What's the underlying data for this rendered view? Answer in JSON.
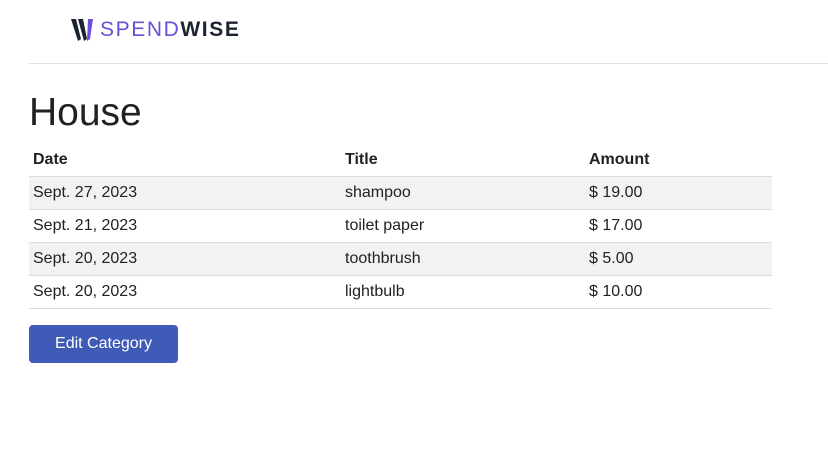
{
  "brand": {
    "spend": "SPEND",
    "wise": "WISE",
    "accent_color": "#6b4fd8",
    "dark_color": "#1b2230"
  },
  "page": {
    "title": "House"
  },
  "table": {
    "headers": {
      "date": "Date",
      "title": "Title",
      "amount": "Amount"
    },
    "rows": [
      {
        "date": "Sept. 27, 2023",
        "title": "shampoo",
        "amount": "$ 19.00"
      },
      {
        "date": "Sept. 21, 2023",
        "title": "toilet paper",
        "amount": "$ 17.00"
      },
      {
        "date": "Sept. 20, 2023",
        "title": "toothbrush",
        "amount": "$ 5.00"
      },
      {
        "date": "Sept. 20, 2023",
        "title": "lightbulb",
        "amount": "$ 10.00"
      }
    ]
  },
  "actions": {
    "edit_category_label": "Edit Category",
    "button_color": "#3f5bb8"
  }
}
